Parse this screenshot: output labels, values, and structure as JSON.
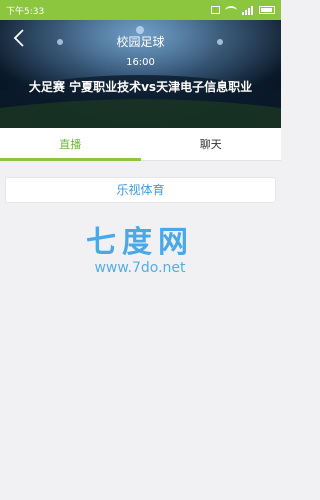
{
  "status_bar": {
    "time": "下午5:33"
  },
  "header": {
    "title": "校园足球",
    "time": "16:00",
    "match": "大足赛 宁夏职业技术vs天津电子信息职业"
  },
  "tabs": [
    {
      "label": "直播",
      "active": true
    },
    {
      "label": "聊天",
      "active": false
    }
  ],
  "channel": {
    "label": "乐视体育"
  },
  "watermark": {
    "logo": "七度网",
    "url": "www.7do.net"
  },
  "colors": {
    "accent": "#8cc63e",
    "tab_active_text": "#6db33f",
    "link": "#3a9be0"
  }
}
